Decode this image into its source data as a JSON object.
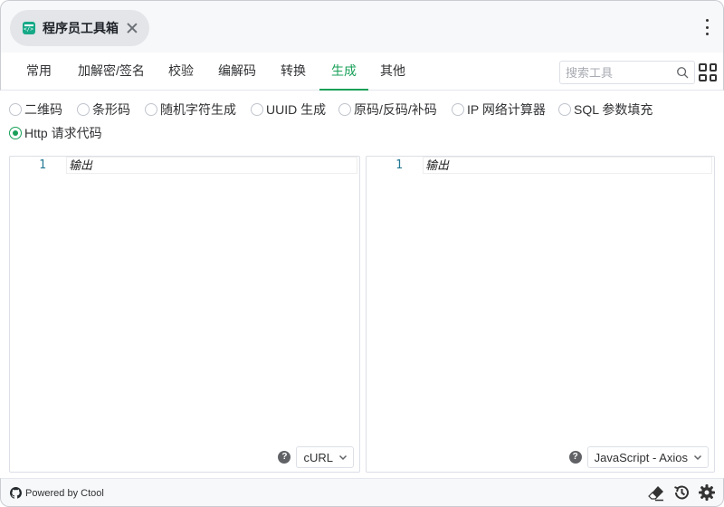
{
  "titlebar": {
    "tab_title": "程序员工具箱",
    "app_icon": "code-window-icon",
    "close_icon": "close-icon",
    "menu_icon": "more-vertical-icon"
  },
  "nav": {
    "items": [
      {
        "label": "常用",
        "active": false
      },
      {
        "label": "加解密/签名",
        "active": false
      },
      {
        "label": "校验",
        "active": false
      },
      {
        "label": "编解码",
        "active": false
      },
      {
        "label": "转换",
        "active": false
      },
      {
        "label": "生成",
        "active": true
      },
      {
        "label": "其他",
        "active": false
      }
    ],
    "search": {
      "placeholder": "搜索工具",
      "value": ""
    },
    "grid_icon": "grid-view-icon"
  },
  "tools": {
    "options": [
      {
        "label": "二维码",
        "checked": false
      },
      {
        "label": "条形码",
        "checked": false
      },
      {
        "label": "随机字符生成",
        "checked": false
      },
      {
        "label": "UUID 生成",
        "checked": false
      },
      {
        "label": "原码/反码/补码",
        "checked": false
      },
      {
        "label": "IP 网络计算器",
        "checked": false
      },
      {
        "label": "SQL 参数填充",
        "checked": false
      },
      {
        "label": "Http 请求代码",
        "checked": true
      }
    ]
  },
  "editors": {
    "left": {
      "line_number": "1",
      "placeholder": "输出",
      "select_value": "cURL"
    },
    "right": {
      "line_number": "1",
      "placeholder": "输出",
      "select_value": "JavaScript - Axios"
    }
  },
  "footer": {
    "powered_by": "Powered by Ctool",
    "icons": [
      "eraser-icon",
      "history-icon",
      "settings-icon"
    ]
  },
  "colors": {
    "accent": "#18a058",
    "line_number": "#237893"
  }
}
